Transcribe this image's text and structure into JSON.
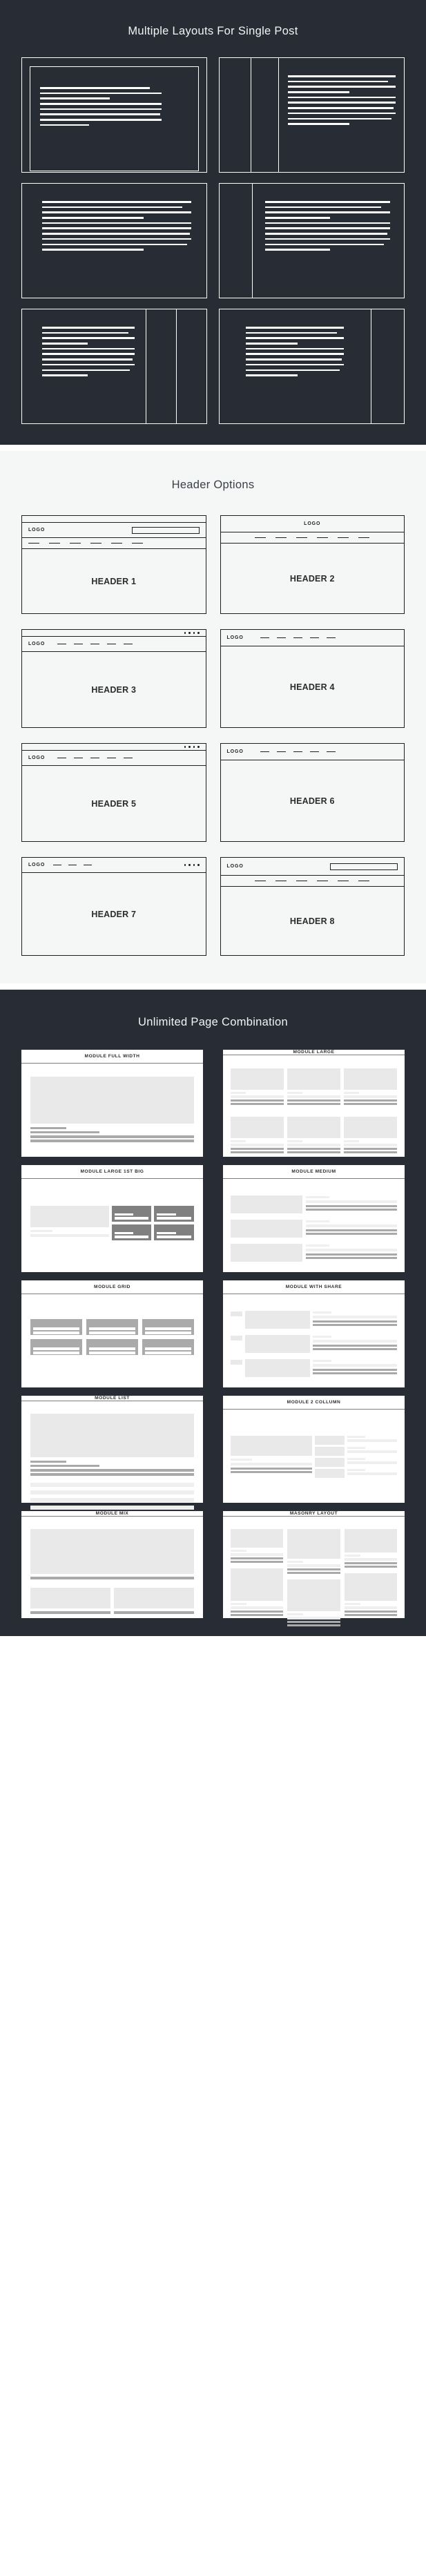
{
  "sections": [
    {
      "id": "layouts",
      "title": "Multiple Layouts For Single Post"
    },
    {
      "id": "headers",
      "title": "Header Options"
    },
    {
      "id": "modules",
      "title": "Unlimited Page Combination"
    }
  ],
  "colors": {
    "dark_bg": "#282d35",
    "light_bg": "#f5f6f6",
    "card_white": "#ffffff",
    "outline": "#ffffff",
    "ink": "#1d1d1d",
    "placeholder_light": "#e9e9e9",
    "placeholder_text_light": "#efefef",
    "placeholder_text_dark": "#a9a9a9",
    "placeholder_mid": "#aaaaaa",
    "placeholder_dark": "#808080"
  },
  "layouts": {
    "cards": [
      {
        "name": "layout-centered-boxed",
        "cols": [
          "main"
        ],
        "inner_box": true,
        "line_widths": [
          74,
          82,
          47,
          82,
          82,
          81,
          82,
          33
        ]
      },
      {
        "name": "layout-two-sidebars-left",
        "cols": [
          "side",
          "side",
          "main"
        ],
        "inner_box": false,
        "line_widths": [
          100,
          93,
          100,
          57,
          100,
          100,
          98,
          100,
          96,
          57
        ]
      },
      {
        "name": "layout-full-width",
        "cols": [
          "main"
        ],
        "inner_box": false,
        "line_widths": [
          85,
          80,
          85,
          58,
          85,
          85,
          84,
          85,
          83,
          58
        ]
      },
      {
        "name": "layout-sidebar-left",
        "cols": [
          "side",
          "main"
        ],
        "inner_box": false,
        "line_widths": [
          100,
          93,
          100,
          52,
          100,
          100,
          98,
          100,
          95,
          52
        ]
      },
      {
        "name": "layout-two-sidebars-right",
        "cols": [
          "main",
          "side",
          "side"
        ],
        "inner_box": false,
        "line_widths": [
          77,
          72,
          77,
          38,
          77,
          77,
          76,
          77,
          74,
          38
        ]
      },
      {
        "name": "layout-sidebar-right",
        "cols": [
          "main",
          "side"
        ],
        "inner_box": false,
        "line_widths": [
          80,
          75,
          80,
          42,
          80,
          80,
          78,
          80,
          76,
          42
        ]
      }
    ]
  },
  "headers": {
    "logo_label": "LOGO",
    "cards": [
      {
        "name": "HEADER 1",
        "variant": "topbar-logo-search-nav"
      },
      {
        "name": "HEADER 2",
        "variant": "centered-logo-nav"
      },
      {
        "name": "HEADER 3",
        "variant": "topbar-dots-logo-nav"
      },
      {
        "name": "HEADER 4",
        "variant": "logo-nav-inline"
      },
      {
        "name": "HEADER 5",
        "variant": "topbar-dots-logo-nav"
      },
      {
        "name": "HEADER 6",
        "variant": "logo-nav-inline"
      },
      {
        "name": "HEADER 7",
        "variant": "logo-nav-dots"
      },
      {
        "name": "HEADER 8",
        "variant": "logo-search-then-nav"
      }
    ]
  },
  "modules": {
    "cards": [
      {
        "name": "MODULE FULL WIDTH",
        "variant": "full-width"
      },
      {
        "name": "MODULE LARGE",
        "variant": "large-grid"
      },
      {
        "name": "MODULE LARGE 1ST BIG",
        "variant": "large-first-big"
      },
      {
        "name": "MODULE MEDIUM",
        "variant": "medium-list"
      },
      {
        "name": "MODULE GRID",
        "variant": "grid"
      },
      {
        "name": "MODULE WITH SHARE",
        "variant": "with-share"
      },
      {
        "name": "MODULE LIST",
        "variant": "list"
      },
      {
        "name": "MODULE 2 COLLUMN",
        "variant": "two-column"
      },
      {
        "name": "MODULE MIX",
        "variant": "mix"
      },
      {
        "name": "MASONRY LAYOUT",
        "variant": "masonry"
      }
    ]
  }
}
